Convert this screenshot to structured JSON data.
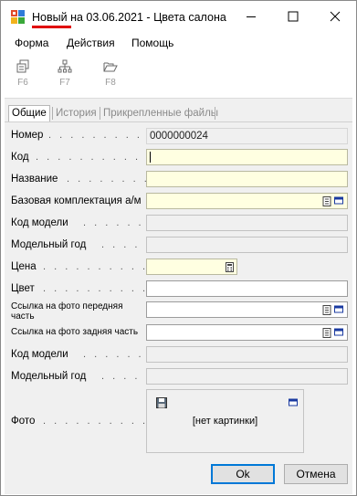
{
  "window": {
    "title_new": "Новый",
    "title_rest": " на 03.06.2021 - Цвета салона"
  },
  "menu": [
    "Форма",
    "Действия",
    "Помощь"
  ],
  "toolbar": [
    {
      "key": "F6",
      "icon": "copy-records-icon"
    },
    {
      "key": "F7",
      "icon": "hierarchy-icon"
    },
    {
      "key": "F8",
      "icon": "open-folder-icon"
    }
  ],
  "tabs": [
    "Общие",
    "История",
    "Прикрепленные файлы"
  ],
  "fields": {
    "nomer": {
      "label": "Номер",
      "value": "0000000024"
    },
    "kod": {
      "label": "Код",
      "value": ""
    },
    "nazvanie": {
      "label": "Название",
      "value": ""
    },
    "baz_kompl": {
      "label": "Базовая комплектация а/м",
      "value": ""
    },
    "kod_modeli_1": {
      "label": "Код модели",
      "value": ""
    },
    "model_god_1": {
      "label": "Модельный год",
      "value": ""
    },
    "cena": {
      "label": "Цена",
      "value": ""
    },
    "cvet": {
      "label": "Цвет",
      "value": ""
    },
    "foto_front": {
      "label_line1": "Ссылка на фото передняя",
      "label_line2": "часть",
      "value": ""
    },
    "foto_back": {
      "label": "Ссылка на фото задняя часть",
      "value": ""
    },
    "kod_modeli_2": {
      "label": "Код модели",
      "value": ""
    },
    "model_god_2": {
      "label": "Модельный год",
      "value": ""
    },
    "foto": {
      "label": "Фото",
      "placeholder": "[нет картинки]"
    }
  },
  "buttons": {
    "ok": "Ok",
    "cancel": "Отмена"
  }
}
